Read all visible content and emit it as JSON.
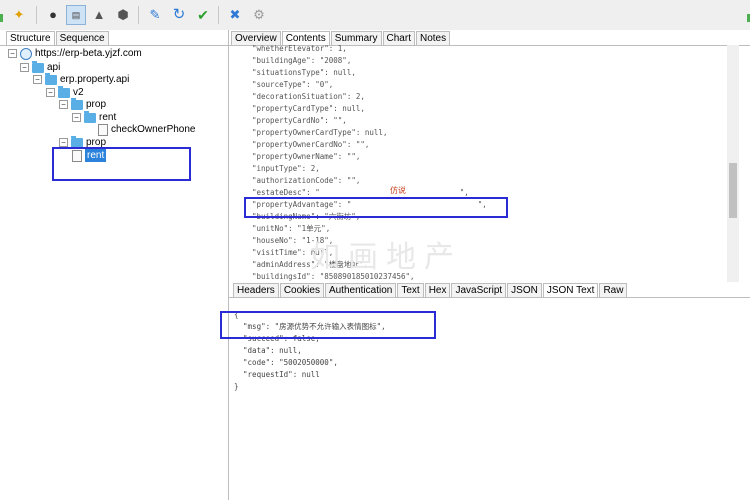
{
  "left_tabs": [
    "Structure",
    "Sequence"
  ],
  "right_top_tabs": [
    "Overview",
    "Contents",
    "Summary",
    "Chart",
    "Notes"
  ],
  "right_bottom_tabs": [
    "Headers",
    "Cookies",
    "Authentication",
    "Text",
    "Hex",
    "JavaScript",
    "JSON",
    "JSON Text",
    "Raw"
  ],
  "tree": {
    "root": "https://erp-beta.yjzf.com",
    "api": "api",
    "property_api": "erp.property.api",
    "v2": "v2",
    "prop1": "prop",
    "rent1": "rent",
    "check": "checkOwnerPhone",
    "prop2": "prop",
    "rent2": "rent"
  },
  "request_lines": [
    "\"whetherElevator\": 1,",
    "\"buildingAge\": \"2008\",",
    "\"situationsType\": null,",
    "\"sourceType\": \"0\",",
    "\"decorationSituation\": 2,",
    "\"propertyCardType\": null,",
    "\"propertyCardNo\": \"\",",
    "\"propertyOwnerCardType\": null,",
    "\"propertyOwnerCardNo\": \"\",",
    "\"propertyOwnerName\": \"\",",
    "\"inputType\": 2,",
    "\"authorizationCode\": \"\",",
    "\"estateDesc\": \"                               \",",
    "\"propertyAdvantage\": \"                            \",",
    "\"buildingName\": \"六街坊\",",
    "\"unitNo\": \"1单元\",",
    "\"houseNo\": \"1-18\",",
    "\"visitTime\": null,",
    "\"adminAddress\": \"楼盘地址\",",
    "\"buildingsId\": \"850890185010237456\","
  ],
  "estate_note": "仿说",
  "watermark": "如画地产",
  "response_lines": [
    "{",
    "  \"msg\": \"房源优势不允许输入表情图标\",",
    "  \"succeed\": false,",
    "  \"data\": null,",
    "  \"code\": \"5002050000\",",
    "  \"requestId\": null",
    "}"
  ]
}
